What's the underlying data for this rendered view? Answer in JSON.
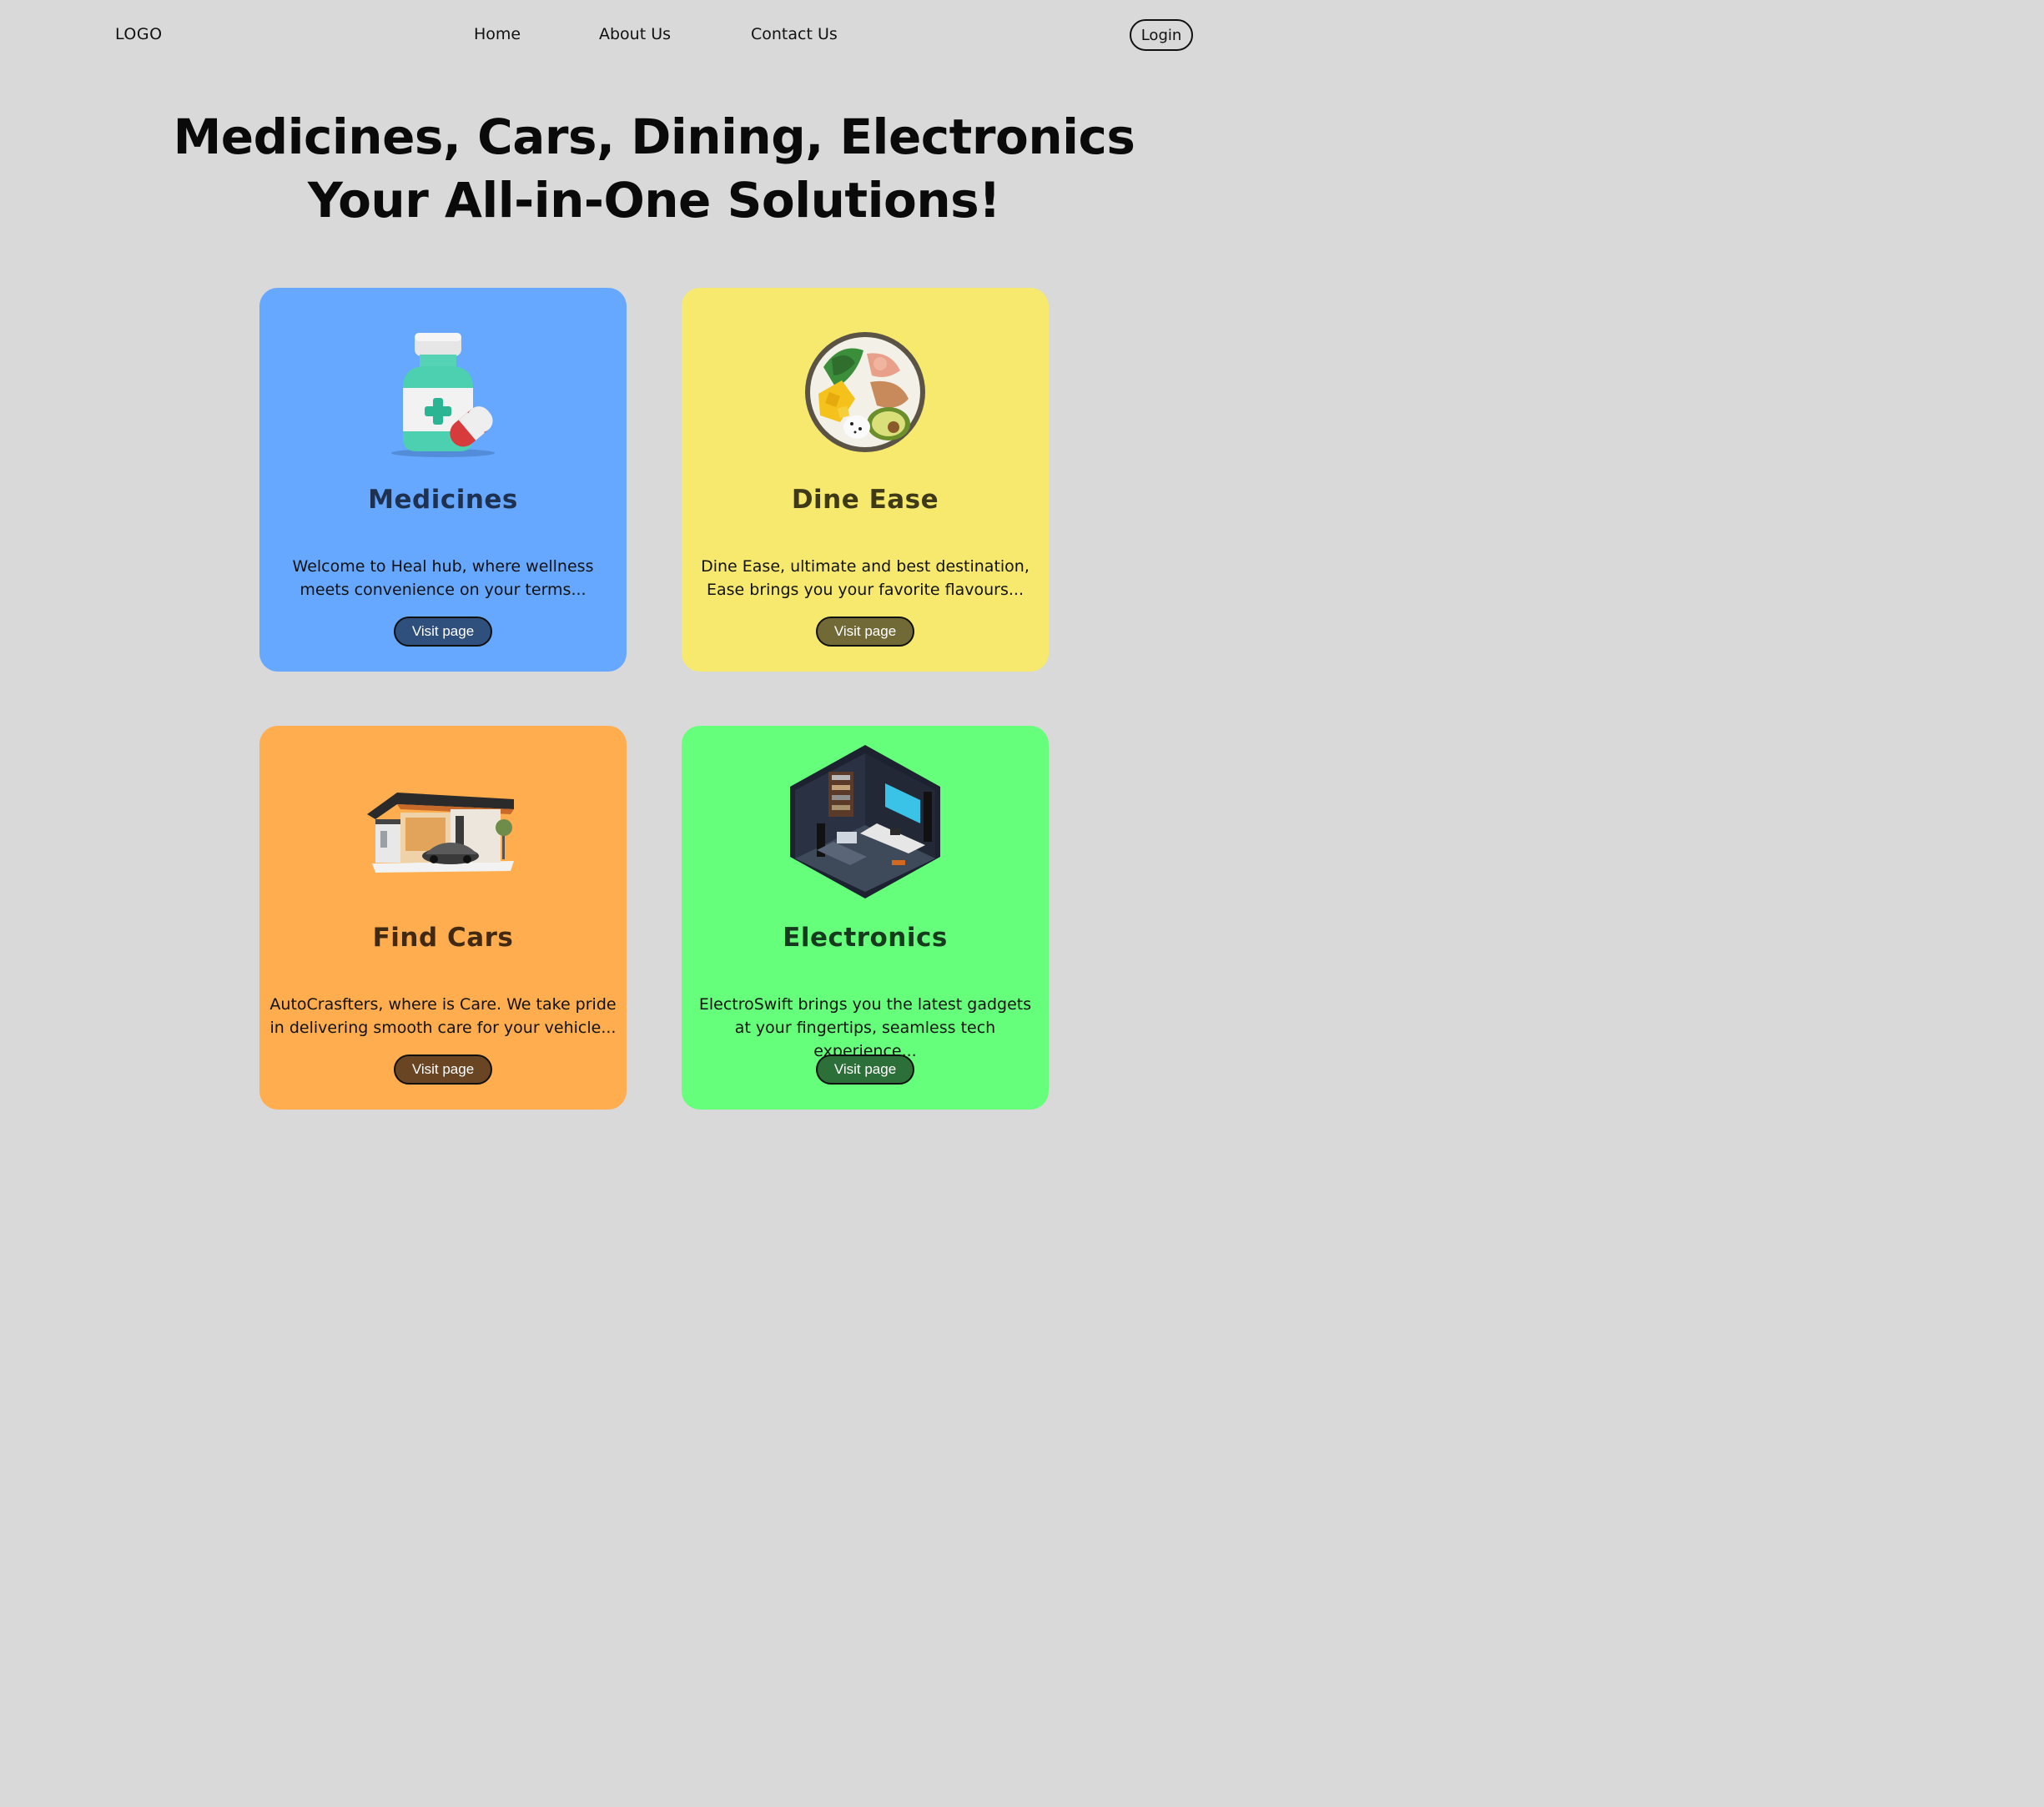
{
  "nav": {
    "logo": "LOGO",
    "links": [
      "Home",
      "About Us",
      "Contact Us"
    ],
    "login": "Login"
  },
  "hero": {
    "line1": "Medicines, Cars, Dining, Electronics",
    "line2": "Your All-in-One Solutions!"
  },
  "cards": [
    {
      "title": "Medicines",
      "description": "Welcome to Heal hub, where wellness meets convenience on your terms...",
      "button": "Visit page",
      "bg": "#66a8ff",
      "title_color": "#1f3150",
      "button_bg": "#2f4f7d",
      "icon": "medicine-bottle-icon"
    },
    {
      "title": "Dine Ease",
      "description": "Dine Ease, ultimate and best destination, Ease brings you your favorite flavours...",
      "button": "Visit page",
      "bg": "#f6e96d",
      "title_color": "#3e3a17",
      "button_bg": "#716a36",
      "icon": "food-bowl-icon"
    },
    {
      "title": "Find Cars",
      "description": "AutoCrasfters, where is Care. We take pride in delivering smooth care for your vehicle...",
      "button": "Visit page",
      "bg": "#ffad4f",
      "title_color": "#412a11",
      "button_bg": "#6a4523",
      "icon": "garage-car-icon"
    },
    {
      "title": "Electronics",
      "description": "ElectroSwift brings you the latest gadgets at your fingertips, seamless tech experience...",
      "button": "Visit page",
      "bg": "#66ff7b",
      "title_color": "#163a1e",
      "button_bg": "#2d6f39",
      "icon": "electronics-room-icon"
    }
  ]
}
